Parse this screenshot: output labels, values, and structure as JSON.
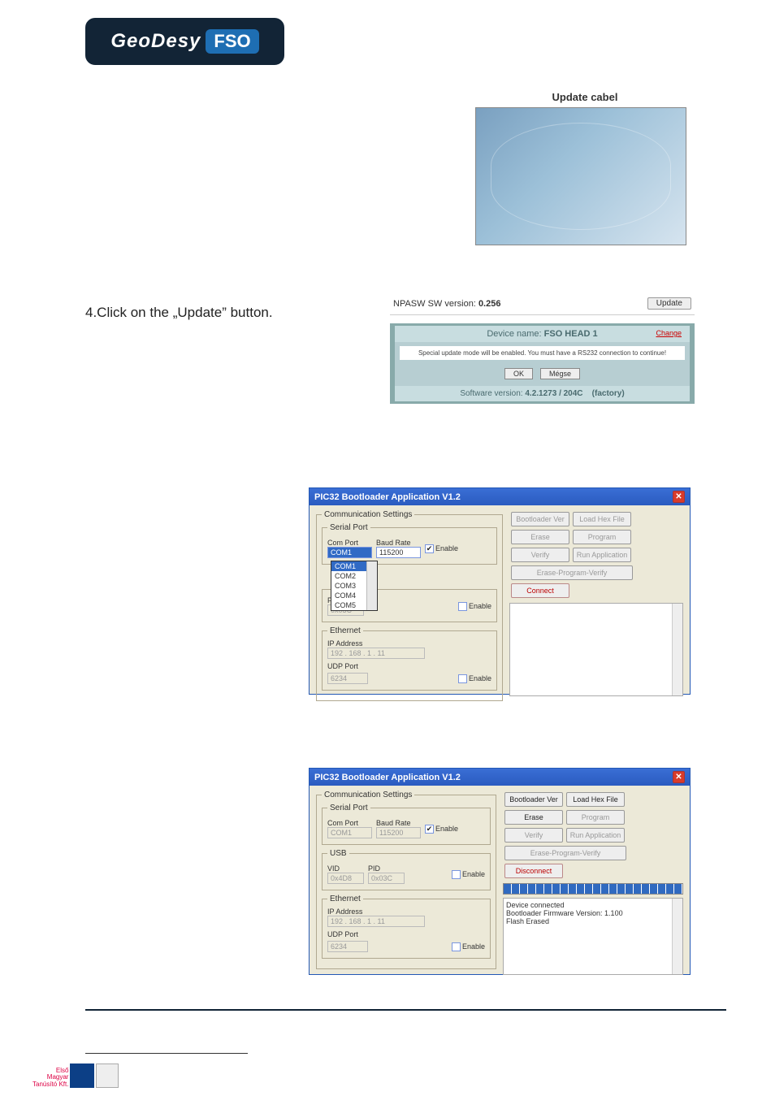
{
  "logo": {
    "left": "GeoDesy",
    "right": "FSO"
  },
  "cable_title": "Update cabel",
  "step_text": "4.Click on the „Update” button.",
  "npasw": {
    "line1_prefix": "NPASW SW version: ",
    "line1_version": "0.256",
    "update_btn": "Update",
    "device_label": "Device name: ",
    "device_value": "FSO HEAD 1",
    "change": "Change",
    "warning": "Special update mode will be enabled. You must have a RS232 connection to continue!",
    "ok": "OK",
    "cancel": "Mégse",
    "sw_label": "Software version: ",
    "sw_value": "4.2.1273 / 204C",
    "factory": "(factory)"
  },
  "bootloader_title": "PIC32 Bootloader Application V1.2",
  "comm": {
    "group": "Communication Settings",
    "serial_group": "Serial Port",
    "com_label": "Com Port",
    "baud_label": "Baud Rate",
    "com_value": "COM1",
    "baud_value": "115200",
    "enable": "Enable",
    "com_options": [
      "COM1",
      "COM2",
      "COM3",
      "COM4",
      "COM5"
    ],
    "usb_group": "USB",
    "vid": "VID",
    "pid": "PID",
    "vid_val": "0x4D8",
    "pid_val": "0x03C",
    "eth_group": "Ethernet",
    "ip_label": "IP Address",
    "ip_val": "192 . 168 .  1  .  11",
    "udp_label": "UDP Port",
    "udp_val": "6234"
  },
  "right_btns": {
    "ver": "Bootloader Ver",
    "load": "Load Hex File",
    "erase": "Erase",
    "prog": "Program",
    "verify": "Verify",
    "run": "Run Application",
    "epv": "Erase-Program-Verify",
    "connect": "Connect",
    "disconnect": "Disconnect"
  },
  "dlg2_log": {
    "l1": "Device connected",
    "l2": "Bootloader Firmware Version: 1.100",
    "l3": "Flash Erased"
  },
  "cert": {
    "l1": "Első",
    "l2": "Magyar",
    "l3": "Tanúsító Kft."
  },
  "chart_data": null
}
